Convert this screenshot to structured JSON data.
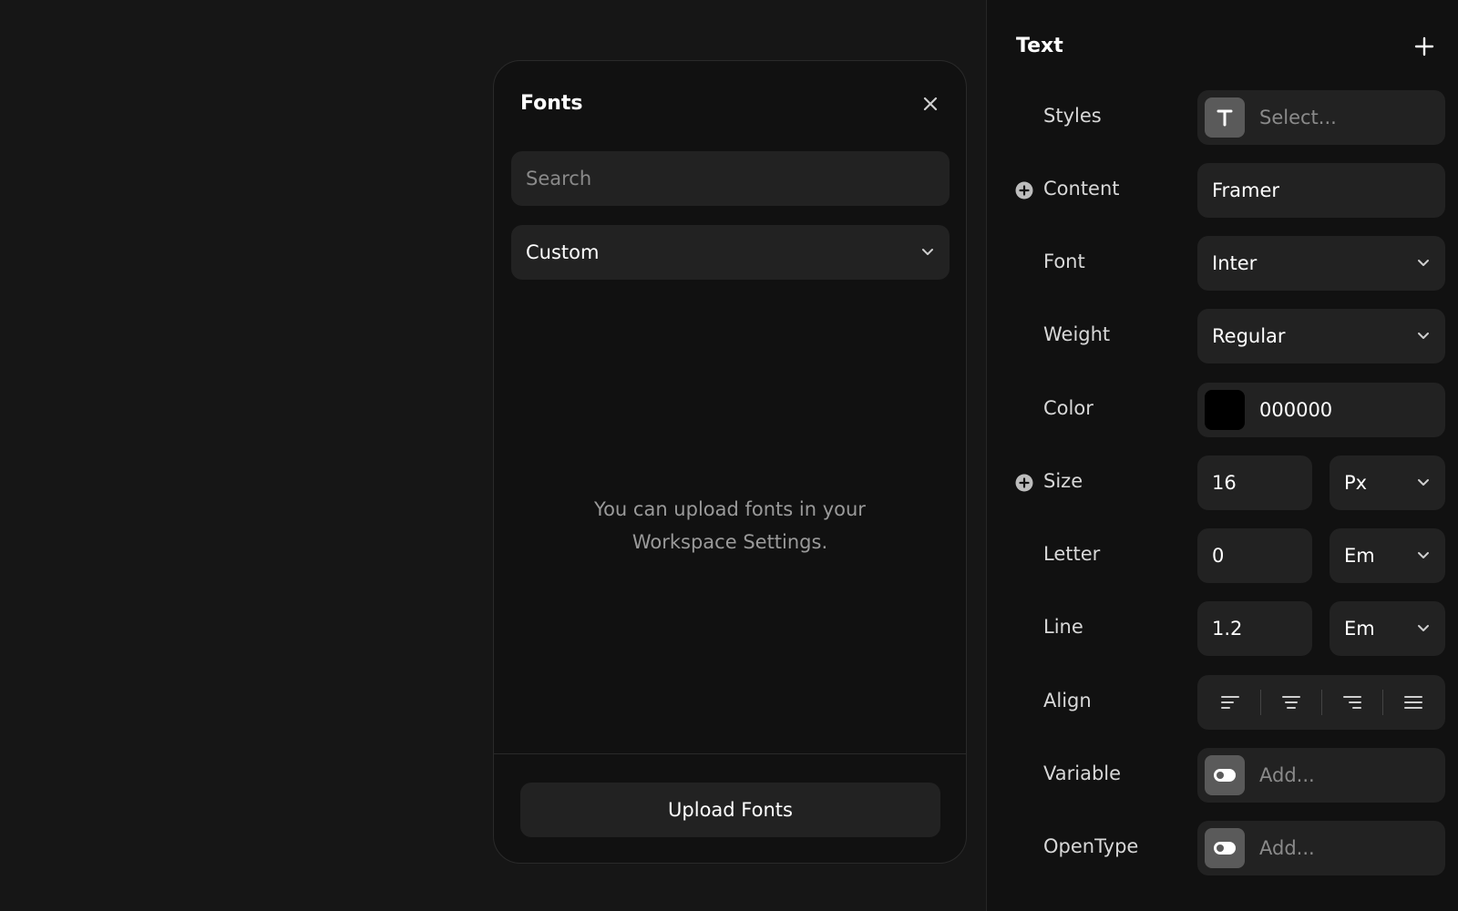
{
  "fonts_panel": {
    "title": "Fonts",
    "search_placeholder": "Search",
    "category": "Custom",
    "empty_line1": "You can upload fonts in your",
    "empty_line2": "Workspace Settings.",
    "upload_label": "Upload Fonts"
  },
  "text_panel": {
    "title": "Text",
    "styles": {
      "label": "Styles",
      "placeholder": "Select..."
    },
    "content": {
      "label": "Content",
      "value": "Framer"
    },
    "font": {
      "label": "Font",
      "value": "Inter"
    },
    "weight": {
      "label": "Weight",
      "value": "Regular"
    },
    "color": {
      "label": "Color",
      "value": "000000",
      "swatch": "#000000"
    },
    "size": {
      "label": "Size",
      "value": "16",
      "unit": "Px"
    },
    "letter": {
      "label": "Letter",
      "value": "0",
      "unit": "Em"
    },
    "line": {
      "label": "Line",
      "value": "1.2",
      "unit": "Em"
    },
    "align": {
      "label": "Align"
    },
    "variable": {
      "label": "Variable",
      "placeholder": "Add..."
    },
    "opentype": {
      "label": "OpenType",
      "placeholder": "Add..."
    }
  },
  "colors": {
    "background": "#161616",
    "panel": "#111111",
    "control": "#222222",
    "chip": "#5a5a5a"
  }
}
